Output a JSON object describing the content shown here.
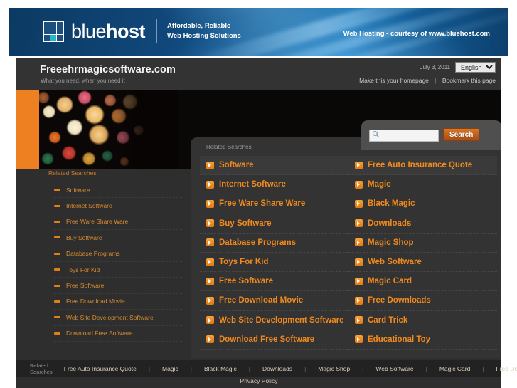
{
  "banner": {
    "logo_word_light": "blue",
    "logo_word_bold": "host",
    "tagline_line1": "Affordable, Reliable",
    "tagline_line2": "Web Hosting Solutions",
    "credit": "Web Hosting - courtesy of www.bluehost.com",
    "accent_color": "#22b8c8",
    "bg_color": "#10477a"
  },
  "header": {
    "site_title": "Freeehrmagicsoftware.com",
    "tagline": "What you need, when you need it",
    "date": "July 3, 2011",
    "language_selected": "English",
    "language_options": [
      "English"
    ],
    "homepage_link": "Make this your homepage",
    "separator": "|",
    "bookmark_link": "Bookmark this page"
  },
  "search": {
    "value": "",
    "placeholder": "",
    "button_label": "Search",
    "icon": "magnifier-icon",
    "button_color": "#c15e1b"
  },
  "sidebar": {
    "label": "Related Searches",
    "items": [
      {
        "label": "Software"
      },
      {
        "label": "Internet Software"
      },
      {
        "label": "Free Ware Share Ware"
      },
      {
        "label": "Buy Software"
      },
      {
        "label": "Database Programs"
      },
      {
        "label": "Toys For Kid"
      },
      {
        "label": "Free Software"
      },
      {
        "label": "Free Download Movie"
      },
      {
        "label": "Web Site Development Software"
      },
      {
        "label": "Download Free Software"
      }
    ]
  },
  "results": {
    "label": "Related Searches",
    "accent_color": "#f08a1e",
    "items": [
      {
        "label": "Software"
      },
      {
        "label": "Internet Software"
      },
      {
        "label": "Free Ware Share Ware"
      },
      {
        "label": "Buy Software"
      },
      {
        "label": "Database Programs"
      },
      {
        "label": "Toys For Kid"
      },
      {
        "label": "Free Software"
      },
      {
        "label": "Free Download Movie"
      },
      {
        "label": "Web Site Development Software"
      },
      {
        "label": "Download Free Software"
      },
      {
        "label": "Free Auto Insurance Quote"
      },
      {
        "label": "Magic"
      },
      {
        "label": "Black Magic"
      },
      {
        "label": "Downloads"
      },
      {
        "label": "Magic Shop"
      },
      {
        "label": "Web Software"
      },
      {
        "label": "Magic Card"
      },
      {
        "label": "Free Downloads"
      },
      {
        "label": "Card Trick"
      },
      {
        "label": "Educational Toy"
      }
    ]
  },
  "footer": {
    "label": "Related Searches:",
    "links": [
      {
        "label": "Free Auto Insurance Quote"
      },
      {
        "label": "Magic"
      },
      {
        "label": "Black Magic"
      },
      {
        "label": "Downloads"
      },
      {
        "label": "Magic Shop"
      },
      {
        "label": "Web Software"
      },
      {
        "label": "Magic Card"
      },
      {
        "label": "Free Downloads"
      }
    ],
    "separator": "|",
    "privacy_policy": "Privacy Policy"
  }
}
